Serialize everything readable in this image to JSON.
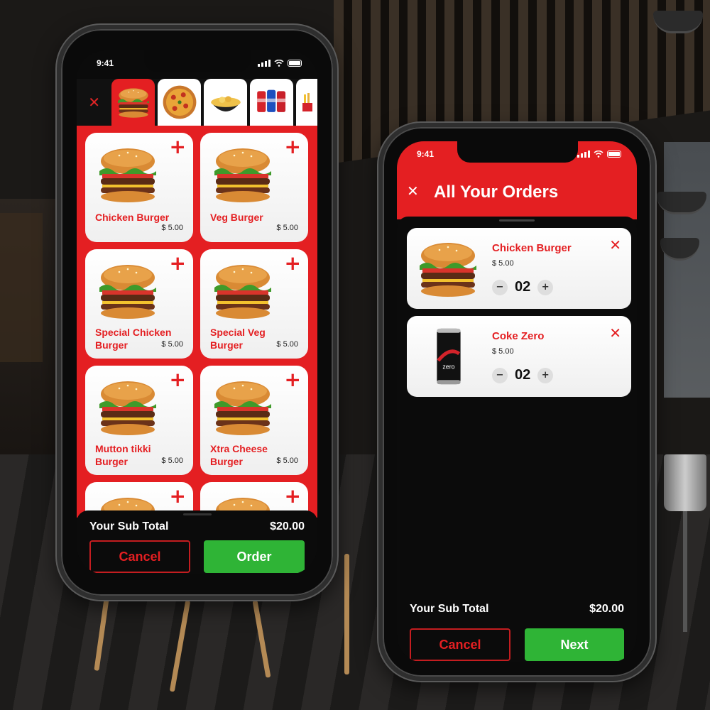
{
  "menu_screen": {
    "status_time": "9:41",
    "categories": [
      {
        "icon": "burger-icon"
      },
      {
        "icon": "pizza-icon"
      },
      {
        "icon": "noodles-icon"
      },
      {
        "icon": "soda-cans-icon"
      },
      {
        "icon": "fries-icon"
      }
    ],
    "items": [
      {
        "name": "Chicken Burger",
        "price": "$ 5.00"
      },
      {
        "name": "Veg Burger",
        "price": "$ 5.00"
      },
      {
        "name": "Special Chicken Burger",
        "price": "$ 5.00"
      },
      {
        "name": "Special Veg Burger",
        "price": "$ 5.00"
      },
      {
        "name": "Mutton tikki Burger",
        "price": "$ 5.00"
      },
      {
        "name": "Xtra Cheese Burger",
        "price": "$ 5.00"
      }
    ],
    "subtotal_label": "Your Sub Total",
    "subtotal_value": "$20.00",
    "cancel_label": "Cancel",
    "order_label": "Order"
  },
  "orders_screen": {
    "status_time": "9:41",
    "title": "All Your Orders",
    "orders": [
      {
        "name": "Chicken Burger",
        "price": "$ 5.00",
        "qty": "02",
        "icon": "burger-icon"
      },
      {
        "name": "Coke Zero",
        "price": "$ 5.00",
        "qty": "02",
        "icon": "coke-can-icon"
      }
    ],
    "subtotal_label": "Your Sub Total",
    "subtotal_value": "$20.00",
    "cancel_label": "Cancel",
    "next_label": "Next"
  },
  "colors": {
    "accent_red": "#e41f22",
    "go_green": "#2fb436",
    "background": "#0b0b0b"
  }
}
